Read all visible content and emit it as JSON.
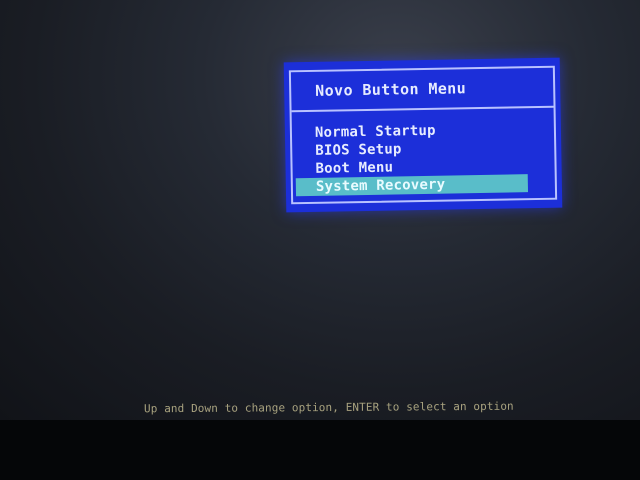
{
  "menu": {
    "title": "Novo Button Menu",
    "items": [
      {
        "label": "Normal Startup",
        "selected": false
      },
      {
        "label": "BIOS Setup",
        "selected": false
      },
      {
        "label": "Boot Menu",
        "selected": false
      },
      {
        "label": "System Recovery",
        "selected": true
      }
    ]
  },
  "footer": {
    "hint": "Up and Down to change option, ENTER to select an option"
  },
  "colors": {
    "menu_background": "#1c2fd9",
    "menu_border": "#b9c2ff",
    "selected_item_background": "#59bdc9",
    "hint_text": "#a8a27f"
  }
}
